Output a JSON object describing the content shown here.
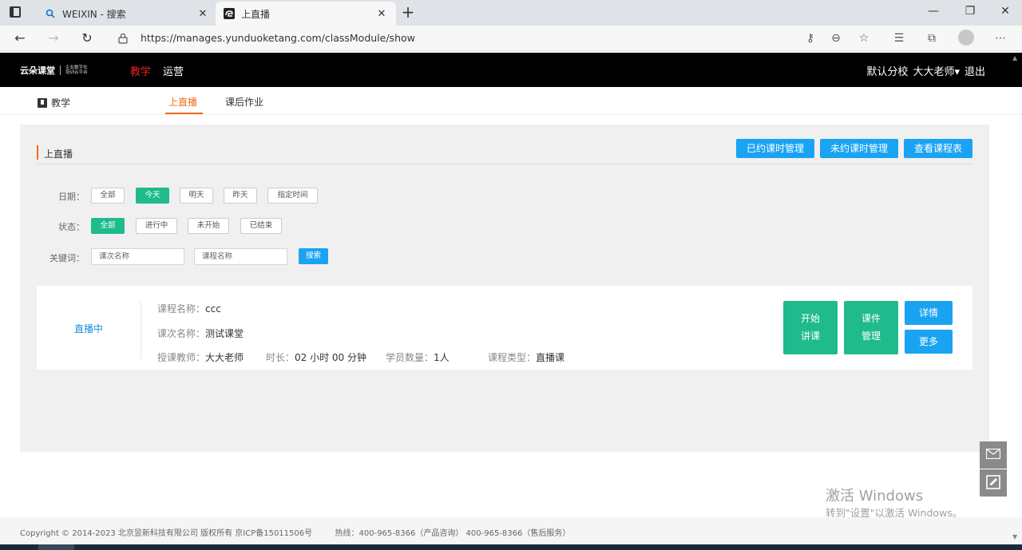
{
  "browser": {
    "tabs": [
      {
        "title": "WEIXIN - 搜索",
        "close": "✕"
      },
      {
        "title": "上直播",
        "close": "✕"
      }
    ],
    "new_tab": "+",
    "window_controls": {
      "minimize": "—",
      "maximize": "❐",
      "close": "✕"
    },
    "url": "https://manages.yunduoketang.com/classModule/show"
  },
  "header": {
    "logo_main": "云朵课堂",
    "logo_sub": "企业数字化培训云平台",
    "nav": [
      "教学",
      "运营"
    ],
    "branch": "默认分校",
    "user": "大大老师",
    "user_caret": "▾",
    "logout": "退出"
  },
  "subnav": {
    "title": "教学",
    "tabs": [
      "上直播",
      "课后作业"
    ]
  },
  "section": {
    "title": "上直播",
    "actions": [
      "已约课时管理",
      "未约课时管理",
      "查看课程表"
    ]
  },
  "filters": {
    "date_label": "日期：",
    "date_options": [
      "全部",
      "今天",
      "明天",
      "昨天",
      "指定时间"
    ],
    "status_label": "状态：",
    "status_options": [
      "全部",
      "进行中",
      "未开始",
      "已结束"
    ],
    "keyword_label": "关键词：",
    "keyword_placeholder_1": "课次名称",
    "keyword_placeholder_2": "课程名称",
    "search": "搜索"
  },
  "course": {
    "status": "直播中",
    "course_name_label": "课程名称：",
    "course_name": "ccc",
    "lesson_name_label": "课次名称：",
    "lesson_name": "测试课堂",
    "teacher_label": "授课教师：",
    "teacher": "大大老师",
    "duration_label": "时长：",
    "duration": "02 小时 00 分钟",
    "students_label": "学员数量：",
    "students": "1人",
    "type_label": "课程类型：",
    "type": "直播课",
    "btn_start_1": "开始",
    "btn_start_2": "讲课",
    "btn_courseware_1": "课件",
    "btn_courseware_2": "管理",
    "btn_detail": "详情",
    "btn_more": "更多"
  },
  "watermark": {
    "line1": "激活 Windows",
    "line2": "转到\"设置\"以激活 Windows。"
  },
  "footer": {
    "copyright": "Copyright © 2014-2023 北京昱新科技有限公司 版权所有 京ICP备15011506号",
    "hotline": "热线：400-965-8366（产品咨询） 400-965-8366（售后服务）"
  },
  "colors": {
    "accent_orange": "#f06b1a",
    "primary_blue": "#1aa3f3",
    "success_green": "#1fbb8c",
    "nav_red": "#e22222"
  }
}
